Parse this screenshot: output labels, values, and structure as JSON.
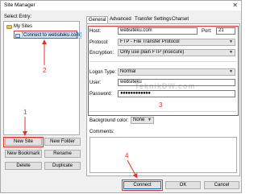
{
  "window": {
    "title": "Site Manager",
    "close_glyph": "✕"
  },
  "select_entry_label": "Select Entry:",
  "tree": {
    "root_label": "My Sites",
    "child_label": "Connect to websiteku.com"
  },
  "left_buttons": {
    "new_site": "New Site",
    "new_folder": "New Folder",
    "new_bookmark": "New Bookmark",
    "rename": "Rename",
    "delete": "Delete",
    "duplicate": "Duplicate"
  },
  "tabs": [
    "General",
    "Advanced",
    "Transfer Settings",
    "Charset"
  ],
  "general": {
    "host_label": "Host:",
    "host_value": "websiteku.com",
    "port_label": "Port:",
    "port_value": "21",
    "protocol_label": "Protocol:",
    "protocol_value": "FTP - File Transfer Protocol",
    "encryption_label": "Encryption:",
    "encryption_value": "Only use plain FTP (insecure)",
    "logon_label": "Logon Type:",
    "logon_value": "Normal",
    "user_label": "User:",
    "user_value": "websiteku",
    "password_label": "Password:",
    "password_value": "●●●●●●●●●●●●",
    "bgcolor_label": "Background color:",
    "bgcolor_value": "None",
    "comments_label": "Comments:"
  },
  "bottom_buttons": {
    "connect": "Connect",
    "ok": "OK",
    "cancel": "Cancel"
  },
  "watermark": "TeknikDW.com",
  "annotations": [
    "1",
    "2",
    "3",
    "4"
  ],
  "colors": {
    "annotation": "#e03030",
    "selection": "#cce8ff",
    "default_button_border": "#0078d7"
  }
}
